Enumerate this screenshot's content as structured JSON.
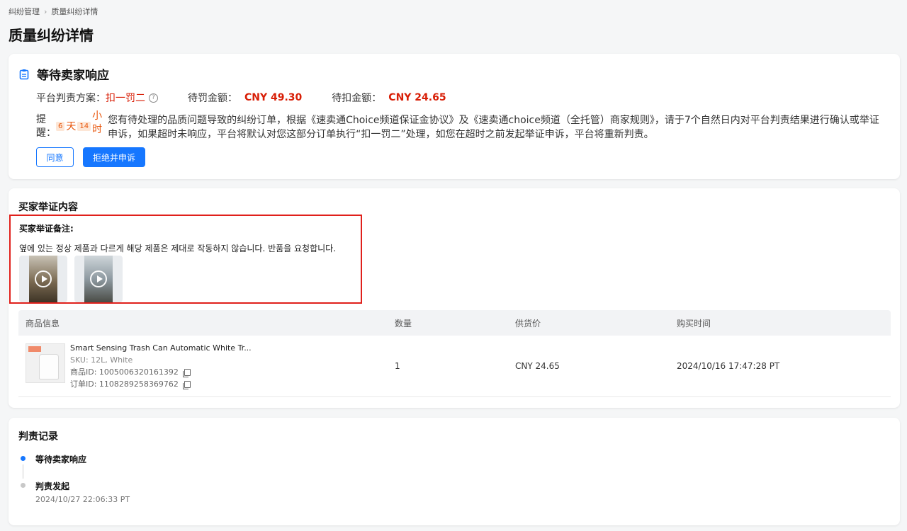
{
  "breadcrumb": {
    "parent": "纠纷管理",
    "current": "质量纠纷详情"
  },
  "page": {
    "title": "质量纠纷详情"
  },
  "status": {
    "title": "等待卖家响应",
    "verdict_label": "平台判责方案：",
    "verdict_value": "扣一罚二",
    "penalty_label": "待罚金额：",
    "penalty_value": "CNY 49.30",
    "deduct_label": "待扣金额：",
    "deduct_value": "CNY 24.65",
    "remind_label": "提醒：",
    "countdown": {
      "days": "6",
      "day_unit": "天",
      "hours": "14",
      "hour_unit": "小时"
    },
    "remind_text": "您有待处理的品质问题导致的纠纷订单，根据《速卖通Choice频道保证金协议》及《速卖通choice频道（全托管）商家规则》，请于7个自然日内对平台判责结果进行确认或举证申诉，如果超时未响应，平台将默认对您这部分订单执行“扣一罚二”处理，如您在超时之前发起举证申诉，平台将重新判责。",
    "agree_label": "同意",
    "appeal_label": "拒绝并申诉"
  },
  "evidence": {
    "section_title": "买家举证内容",
    "note_label": "买家举证备注:",
    "note_text": "옆에 있는 정상 제품과 다르게 해당 제품은 제대로 작동하지 않습니다. 반품을 요청합니다."
  },
  "table": {
    "headers": [
      "商品信息",
      "数量",
      "供货价",
      "购买时间"
    ],
    "rows": [
      {
        "name": "Smart Sensing Trash Can Automatic White Tr...",
        "sku": "SKU: 12L, White",
        "product_id": "商品ID: 1005006320161392",
        "order_id": "订单ID: 1108289258369762",
        "quantity": "1",
        "price": "CNY 24.65",
        "purchase_time": "2024/10/16 17:47:28 PT"
      }
    ]
  },
  "records": {
    "section_title": "判责记录",
    "items": [
      {
        "title": "等待卖家响应"
      },
      {
        "title": "判责发起",
        "time": "2024/10/27 22:06:33 PT"
      }
    ]
  },
  "colors": {
    "accent": "#1677ff",
    "danger": "#d81e06",
    "countdown": "#e8560c",
    "highlight_border": "#e0201b"
  }
}
